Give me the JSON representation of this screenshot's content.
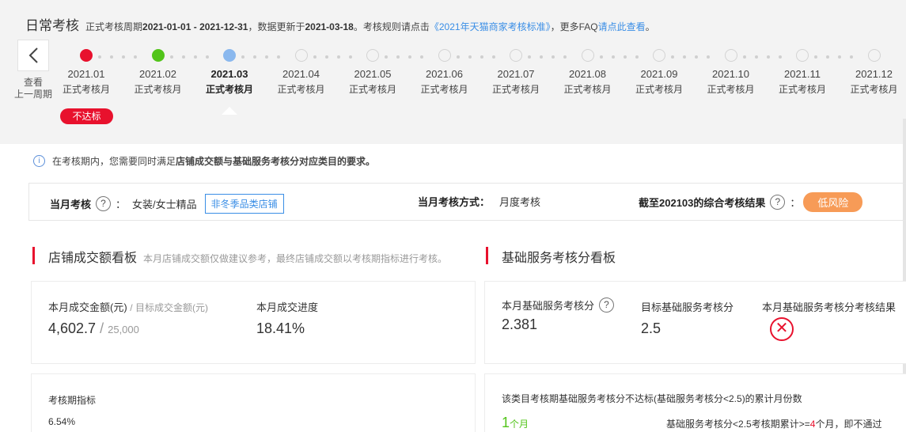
{
  "header": {
    "title": "日常考核",
    "desc_prefix": "正式考核周期",
    "period": "2021-01-01 - 2021-12-31",
    "desc_update": "，数据更新于",
    "update_date": "2021-03-18",
    "desc_rule": "。考核规则请点击",
    "rule_link": "《2021年天猫商家考核标准》",
    "desc_faq": "，更多FAQ",
    "faq_link": "请点此查看",
    "desc_end": "。"
  },
  "prev_period": {
    "line1": "查看",
    "line2": "上一周期"
  },
  "months": [
    {
      "label": "2021.01",
      "sub": "正式考核月",
      "status": "red"
    },
    {
      "label": "2021.02",
      "sub": "正式考核月",
      "status": "green"
    },
    {
      "label": "2021.03",
      "sub": "正式考核月",
      "status": "blue"
    },
    {
      "label": "2021.04",
      "sub": "正式考核月",
      "status": "empty"
    },
    {
      "label": "2021.05",
      "sub": "正式考核月",
      "status": "empty"
    },
    {
      "label": "2021.06",
      "sub": "正式考核月",
      "status": "empty"
    },
    {
      "label": "2021.07",
      "sub": "正式考核月",
      "status": "empty"
    },
    {
      "label": "2021.08",
      "sub": "正式考核月",
      "status": "empty"
    },
    {
      "label": "2021.09",
      "sub": "正式考核月",
      "status": "empty"
    },
    {
      "label": "2021.10",
      "sub": "正式考核月",
      "status": "empty"
    },
    {
      "label": "2021.11",
      "sub": "正式考核月",
      "status": "empty"
    },
    {
      "label": "2021.12",
      "sub": "正式考核月",
      "status": "empty"
    }
  ],
  "fail_badge": "不达标",
  "notice": {
    "prefix": "在考核期内，您需要同时满足",
    "bold": "店铺成交额与基础服务考核分对应类目的要求。"
  },
  "assessment": {
    "monthly_label": "当月考核",
    "colon": "：",
    "category": "女装/女士精品",
    "category_tag": "非冬季品类店铺",
    "method_label": "当月考核方式：",
    "method_value": "月度考核",
    "result_label": "截至202103的综合考核结果",
    "result_value": "低风险"
  },
  "sales_board": {
    "title": "店铺成交额看板",
    "note": "本月店铺成交额仅做建议参考，最终店铺成交额以考核期指标进行考核。",
    "amount_label": "本月成交金额(元)",
    "target_label": "/ 目标成交金额(元)",
    "amount_value": "4,602.7",
    "target_value": "25,000",
    "progress_label": "本月成交进度",
    "progress_value": "18.41%",
    "period_label": "考核期指标",
    "period_value": "6.54%"
  },
  "service_board": {
    "title": "基础服务考核分看板",
    "score_label": "本月基础服务考核分",
    "score_value": "2.381",
    "target_label": "目标基础服务考核分",
    "target_value": "2.5",
    "result_label": "本月基础服务考核分考核结果",
    "fail_label": "该类目考核期基础服务考核分不达标(基础服务考核分<2.5)的累计月份数",
    "fail_count": "1",
    "fail_unit": "个月",
    "rule_text_1": "基础服务考核分<2.5考核期累计>=",
    "rule_num": "4",
    "rule_text_2": "个月，即不通过"
  },
  "colors": {
    "accent_red": "#e8112d",
    "green": "#52c41a",
    "blue": "#3a8ee6",
    "orange": "#f79b57"
  }
}
